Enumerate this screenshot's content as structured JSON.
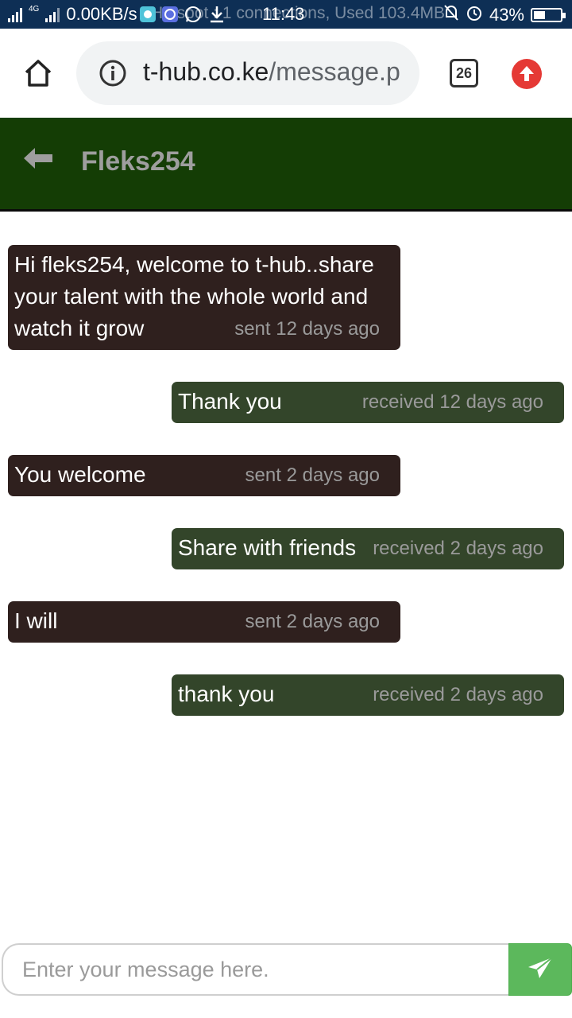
{
  "status_bar": {
    "network_type": "4G",
    "speed": "0.00KB/s",
    "hotspot_text": "Hotspot : 1 connections, Used 103.4MB",
    "time": "11:43",
    "battery": "43%",
    "battery_level": 0.43
  },
  "browser": {
    "url_host": "t-hub.co.ke",
    "url_path": "/message.p",
    "tab_count": "26"
  },
  "header": {
    "title": "Fleks254"
  },
  "messages": [
    {
      "type": "sent",
      "text": "Hi fleks254, welcome to t-hub..share your talent with the whole world and watch it grow",
      "time": "sent 12 days ago"
    },
    {
      "type": "received",
      "text": "Thank you",
      "time": "received 12 days ago"
    },
    {
      "type": "sent",
      "text": "You welcome",
      "time": "sent 2 days ago"
    },
    {
      "type": "received",
      "text": "Share with friends",
      "time": "received 2 days ago"
    },
    {
      "type": "sent",
      "text": "I will",
      "time": "sent 2 days ago"
    },
    {
      "type": "received",
      "text": "thank you",
      "time": "received 2 days ago"
    }
  ],
  "composer": {
    "placeholder": "Enter your message here.",
    "value": "",
    "send_icon": "send-icon"
  },
  "colors": {
    "header_bg": "#143d05",
    "sent_bubble": "#2f201e",
    "received_bubble": "#33452a",
    "send_button": "#5cb85c"
  }
}
